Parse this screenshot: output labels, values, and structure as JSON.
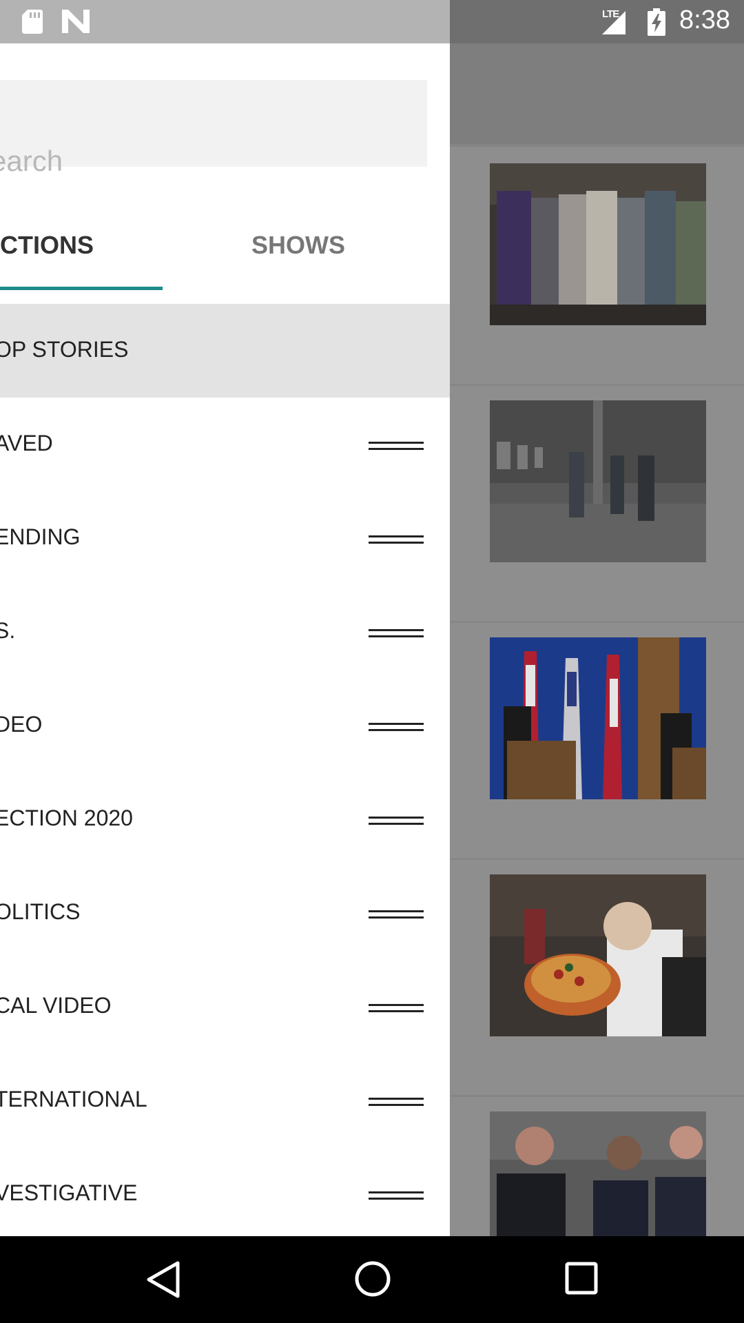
{
  "status_bar": {
    "time": "8:38",
    "network": "LTE",
    "icons": [
      "sd-card-icon",
      "n-logo-icon",
      "signal-icon",
      "battery-charging-icon"
    ]
  },
  "drawer": {
    "search": {
      "placeholder": "earch"
    },
    "tabs": [
      {
        "label": "CTIONS",
        "selected": true
      },
      {
        "label": "SHOWS",
        "selected": false
      }
    ],
    "accent_color": "#1f8c8a",
    "sections": [
      {
        "label": "OP STORIES",
        "active": true
      },
      {
        "label": "AVED"
      },
      {
        "label": "ENDING"
      },
      {
        "label": "S."
      },
      {
        "label": "DEO"
      },
      {
        "label": "ECTION 2020"
      },
      {
        "label": "OLITICS"
      },
      {
        "label": "CAL VIDEO"
      },
      {
        "label": "TERNATIONAL"
      },
      {
        "label": "VESTIGATIVE"
      }
    ]
  },
  "feed": {
    "thumbnails": [
      "crowd-embracing-photo",
      "men-in-warehouse-photo",
      "press-conference-flags-photo",
      "chef-with-pizza-photo",
      "men-in-suits-courthouse-photo"
    ]
  },
  "nav_bar": {
    "buttons": [
      "back-icon",
      "home-icon",
      "recents-icon"
    ]
  }
}
